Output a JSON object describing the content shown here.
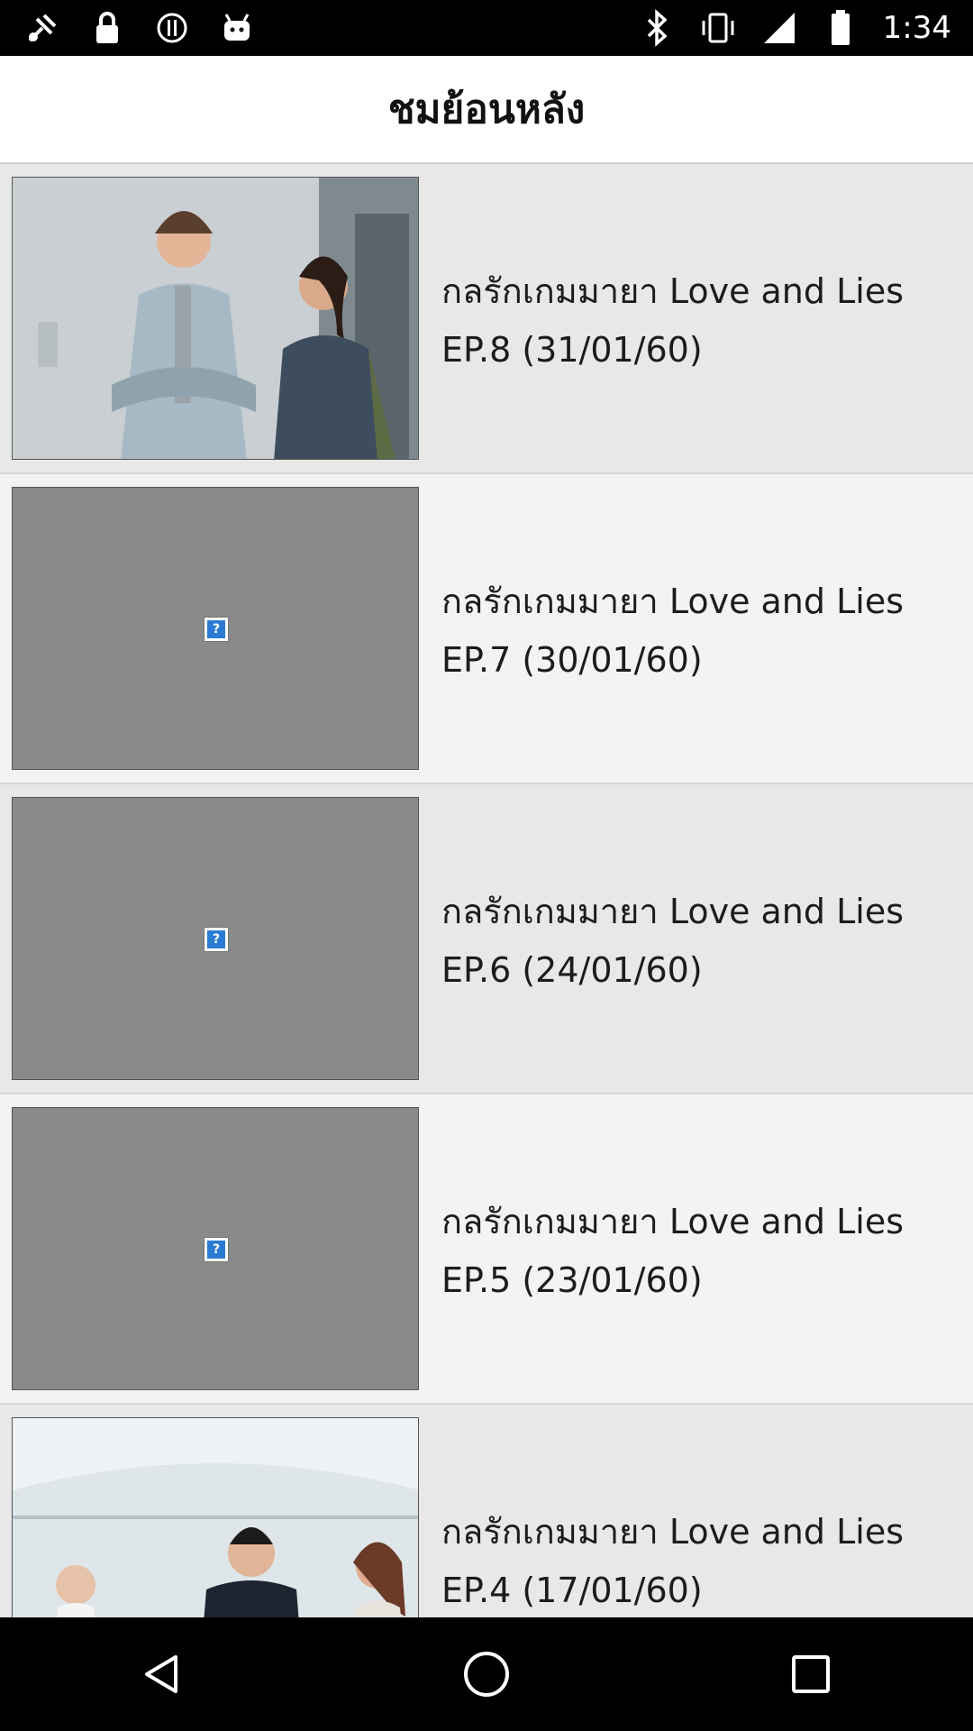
{
  "status_bar": {
    "time": "1:34",
    "left_icons": [
      "fake-gps-icon",
      "lock-icon",
      "alert-icon",
      "android-icon"
    ],
    "right_icons": [
      "bluetooth-icon",
      "vibrate-icon",
      "signal-icon",
      "battery-icon"
    ]
  },
  "header": {
    "title": "ชมย้อนหลัง"
  },
  "episodes": [
    {
      "title": "กลรักเกมมายา Love and Lies",
      "episode": "EP.8  (31/01/60)",
      "thumbnail": "photo"
    },
    {
      "title": "กลรักเกมมายา Love and Lies",
      "episode": "EP.7  (30/01/60)",
      "thumbnail": "broken"
    },
    {
      "title": "กลรักเกมมายา Love and Lies",
      "episode": "EP.6  (24/01/60)",
      "thumbnail": "broken"
    },
    {
      "title": "กลรักเกมมายา Love and Lies",
      "episode": "EP.5  (23/01/60)",
      "thumbnail": "broken"
    },
    {
      "title": "กลรักเกมมายา Love and Lies",
      "episode": "EP.4  (17/01/60)",
      "thumbnail": "photo"
    }
  ],
  "nav": {
    "icons": [
      "back-icon",
      "home-icon",
      "recents-icon"
    ]
  },
  "colors": {
    "status_bg": "#000000",
    "header_bg": "#ffffff",
    "row_alt_1": "#e8e8e8",
    "row_alt_2": "#f3f3f3",
    "placeholder": "#8a8a8a"
  }
}
